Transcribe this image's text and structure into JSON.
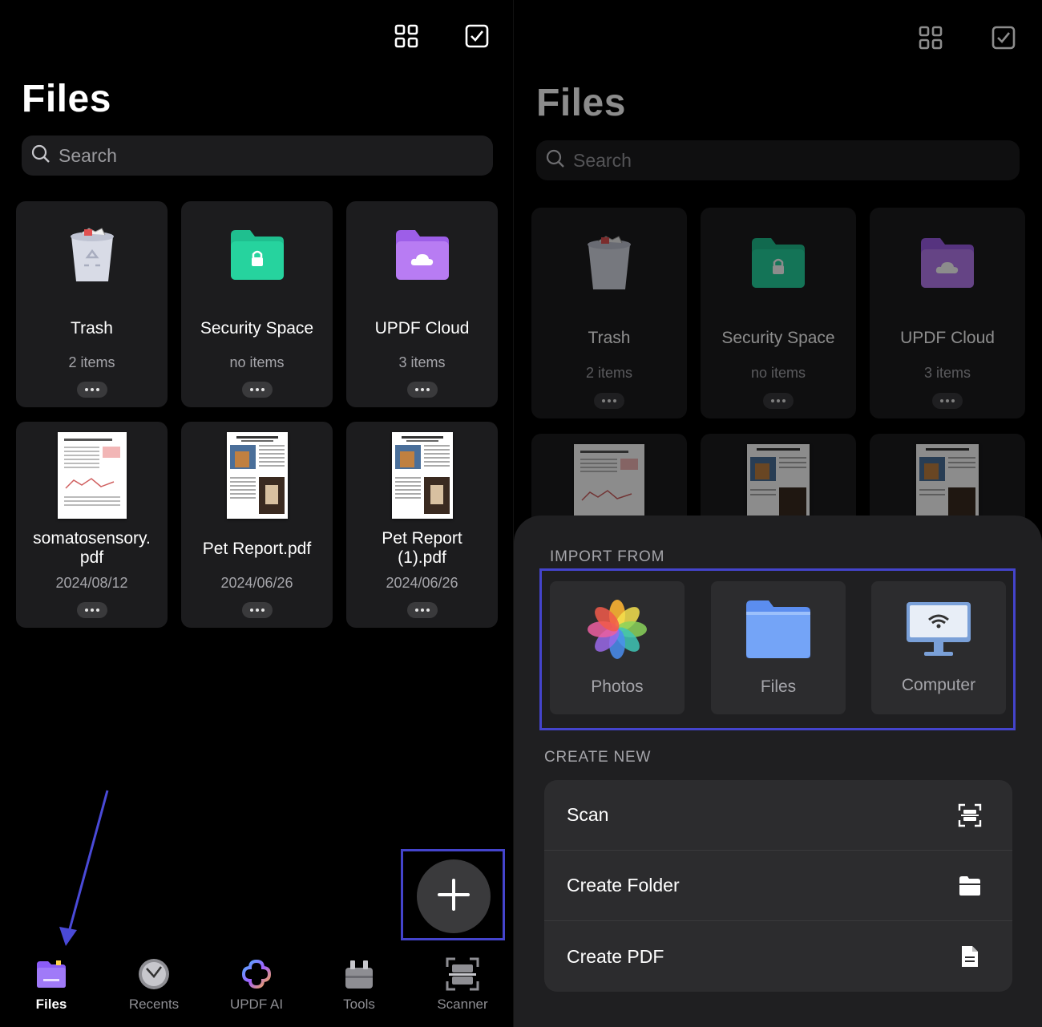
{
  "left": {
    "title": "Files",
    "search_placeholder": "Search",
    "folders": [
      {
        "name": "Trash",
        "sub": "2 items",
        "icon": "trash-icon"
      },
      {
        "name": "Security Space",
        "sub": "no items",
        "icon": "lock-folder-icon"
      },
      {
        "name": "UPDF Cloud",
        "sub": "3 items",
        "icon": "cloud-folder-icon"
      }
    ],
    "files": [
      {
        "name_line1": "somatosensory.",
        "name_line2": "pdf",
        "date": "2024/08/12"
      },
      {
        "name_line1": "Pet Report.pdf",
        "name_line2": "",
        "date": "2024/06/26"
      },
      {
        "name_line1": "Pet Report",
        "name_line2": "(1).pdf",
        "date": "2024/06/26"
      }
    ],
    "tabs": [
      {
        "label": "Files",
        "icon": "files-tab-icon",
        "active": true
      },
      {
        "label": "Recents",
        "icon": "clock-icon",
        "active": false
      },
      {
        "label": "UPDF AI",
        "icon": "ai-icon",
        "active": false
      },
      {
        "label": "Tools",
        "icon": "toolbox-icon",
        "active": false
      },
      {
        "label": "Scanner",
        "icon": "scanner-icon",
        "active": false
      }
    ],
    "fab_icon": "plus-icon"
  },
  "right": {
    "title": "Files",
    "search_placeholder": "Search",
    "folders": [
      {
        "name": "Trash",
        "sub": "2 items"
      },
      {
        "name": "Security Space",
        "sub": "no items"
      },
      {
        "name": "UPDF Cloud",
        "sub": "3 items"
      }
    ],
    "sheet": {
      "import_label": "IMPORT FROM",
      "import_sources": [
        {
          "label": "Photos",
          "icon": "photos-icon"
        },
        {
          "label": "Files",
          "icon": "files-folder-icon"
        },
        {
          "label": "Computer",
          "icon": "computer-wifi-icon"
        }
      ],
      "create_label": "CREATE NEW",
      "create_items": [
        {
          "label": "Scan",
          "icon": "scan-icon"
        },
        {
          "label": "Create Folder",
          "icon": "folder-icon"
        },
        {
          "label": "Create PDF",
          "icon": "document-icon"
        }
      ]
    }
  },
  "colors": {
    "highlight": "#4444cc",
    "files_tab": "#8b5cf6",
    "security_folder": "#1fbf8f",
    "cloud_folder": "#b06cf0"
  }
}
